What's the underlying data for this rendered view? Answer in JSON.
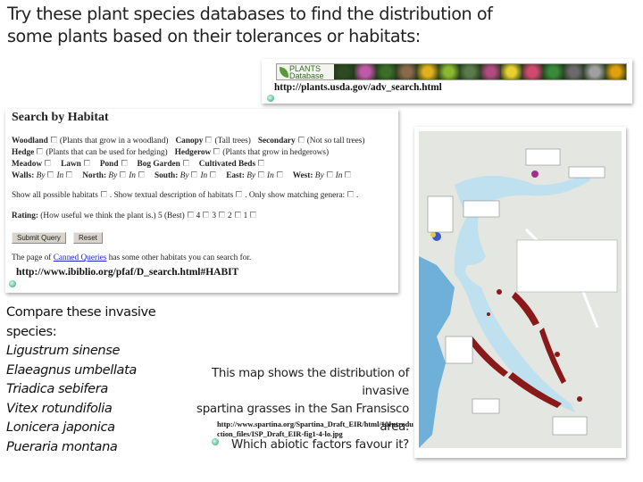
{
  "title": {
    "line1": "Try these plant species databases to find the distribution of",
    "line2": "some plants based on their tolerances or habitats:"
  },
  "plants_db": {
    "logo": "PLANTS Database",
    "url": "http://plants.usda.gov/adv_search.html",
    "photo_colors": [
      "#2d4a22",
      "#c05aa8",
      "#3c6e2a",
      "#8a6a4a",
      "#e0b020",
      "#8ab830",
      "#5a7a4a",
      "#b04a80",
      "#e8d030",
      "#d04a70",
      "#3a8a3a",
      "#6a6a6a",
      "#a0a0a0",
      "#e0a010"
    ]
  },
  "habitat_form": {
    "title": "Search by Habitat",
    "row1": [
      {
        "label": "Woodland",
        "note": "(Plants that grow in a woodland)"
      },
      {
        "label": "Canopy",
        "note": "(Tall trees)"
      },
      {
        "label": "Secondary",
        "note": "(Not so tall trees)"
      }
    ],
    "row2": [
      {
        "label": "Hedge",
        "note": "(Plants that can be used for hedging)"
      },
      {
        "label": "Hedgerow",
        "note": "(Plants that grow in hedgerows)"
      }
    ],
    "row3": [
      {
        "label": "Meadow"
      },
      {
        "label": "Lawn"
      },
      {
        "label": "Pond"
      },
      {
        "label": "Bog Garden"
      },
      {
        "label": "Cultivated Beds"
      }
    ],
    "walls": [
      {
        "label": "Walls:"
      },
      {
        "label": "North:"
      },
      {
        "label": "South:"
      },
      {
        "label": "East:"
      },
      {
        "label": "West:"
      }
    ],
    "by": "By",
    "in": "In",
    "options": [
      "Show all possible habitats",
      ". Show textual description of habitats",
      ". Only show matching genera:",
      "."
    ],
    "rating": {
      "label": "Rating:",
      "note": "(How useful we think the plant is.)",
      "values": [
        "5 (Best)",
        "4",
        "3",
        "2",
        "1"
      ]
    },
    "submit": "Submit Query",
    "reset": "Reset",
    "canned": {
      "prefix": "The page of ",
      "link": "Canned Queries",
      "suffix": " has some other habitats you can search for."
    },
    "url": "http://www.ibiblio.org/pfaf/D_search.html#HABIT"
  },
  "species": {
    "heading": "Compare these invasive species:",
    "list": [
      "Ligustrum sinense",
      "Elaeagnus umbellata",
      "Triadica sebifera",
      "Vitex rotundifolia",
      "Lonicera japonica",
      "Pueraria montana"
    ]
  },
  "map_caption": {
    "line1": "This map shows the distribution of invasive",
    "line2": "spartina grasses in the San Fransisco area.",
    "line3": "Which abiotic factors favour it?",
    "url": "http://www.spartina.org/Spartina_Draft_EIR/html/10Introduction_files/ISP_Draft_EIR-fig1-4-lo.jpg"
  },
  "colors": {
    "water": "#bfe0ee",
    "land": "#e4e6e2",
    "spartina": "#8a1a1a"
  }
}
